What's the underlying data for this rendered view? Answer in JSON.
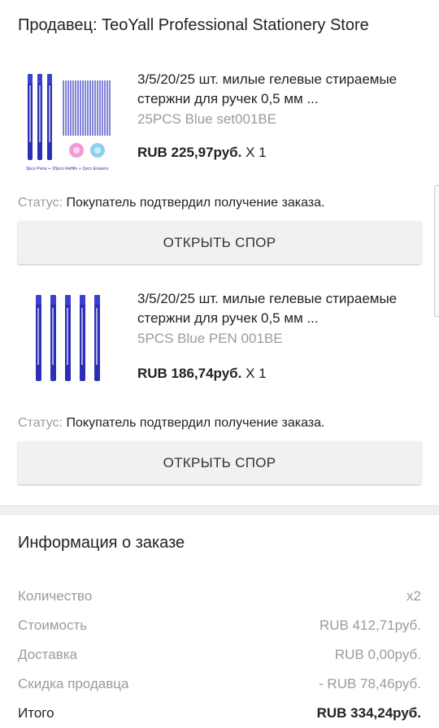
{
  "seller": {
    "label": "Продавец:",
    "name": "TeoYall Professional Stationery Store"
  },
  "items": [
    {
      "title": "3/5/20/25 шт. милые гелевые стираемые стержни для ручек 0,5 мм ...",
      "sku": "25PCS Blue set001BE",
      "price": "RUB 225,97руб.",
      "qty": "X 1",
      "status_label": "Статус:",
      "status_text": "Покупатель подтвердил получение заказа.",
      "dispute_label": "ОТКРЫТЬ СПОР",
      "image_caption": "3pcs Pens + 20pcs Refills + 2pcs Erasers"
    },
    {
      "title": "3/5/20/25 шт. милые гелевые стираемые стержни для ручек 0,5 мм ...",
      "sku": "5PCS Blue PEN 001BE",
      "price": "RUB 186,74руб.",
      "qty": "X 1",
      "status_label": "Статус:",
      "status_text": "Покупатель подтвердил получение заказа.",
      "dispute_label": "ОТКРЫТЬ СПОР"
    }
  ],
  "order_info": {
    "title": "Информация о заказе",
    "rows": [
      {
        "label": "Количество",
        "value": "x2"
      },
      {
        "label": "Стоимость",
        "value": "RUB 412,71руб."
      },
      {
        "label": "Доставка",
        "value": "RUB 0,00руб."
      },
      {
        "label": "Скидка продавца",
        "value": "- RUB 78,46руб."
      },
      {
        "label": "Итого",
        "value": "RUB 334,24руб."
      }
    ]
  },
  "colors": {
    "pen_blue": "#2b2fb8",
    "muted_text": "#9b9b9b",
    "button_bg": "#f1f1f1"
  }
}
